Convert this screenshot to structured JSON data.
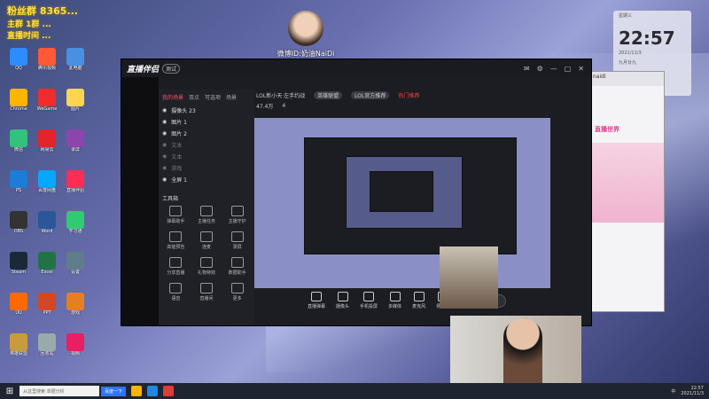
{
  "overlay": {
    "line1": "粉丝群 8365...",
    "line2": "主群 1群 ...",
    "line3": "直播时间 ..."
  },
  "weibo": {
    "text": "微博ID:奶油NaiDi"
  },
  "desktop": {
    "icons": [
      "QQ",
      "Chrome",
      "微信",
      "PS",
      "OBS",
      "Steam",
      "UU",
      "英雄联盟",
      "腾讯视频",
      "WeGame",
      "网易云",
      "百度网盘",
      "Word",
      "Excel",
      "PPT",
      "回收站",
      "此电脑",
      "图片",
      "录屏",
      "直播伴侣",
      "学习通",
      "设置",
      "游戏",
      "视频"
    ]
  },
  "app": {
    "logo": "直播伴侣",
    "version": "测试",
    "tabs": [
      "我的场景",
      "双点",
      "可选项",
      "场景"
    ],
    "scenes": [
      {
        "label": "摄像头 23",
        "dim": false
      },
      {
        "label": "图片 1",
        "dim": false
      },
      {
        "label": "图片 2",
        "dim": false
      },
      {
        "label": "文本",
        "dim": true
      },
      {
        "label": "文本",
        "dim": true
      },
      {
        "label": "游戏",
        "dim": true
      },
      {
        "label": "全屏 1",
        "dim": false
      }
    ],
    "tools_title": "工具箱",
    "tools": [
      "弹幕助手",
      "主播任务",
      "主播守护",
      "高能预告",
      "连麦",
      "录屏",
      "分享直播",
      "礼物特效",
      "数据助手",
      "语音",
      "直播间",
      "更多"
    ],
    "room": {
      "title": "LOL新小天·左手约战",
      "category": "英雄联盟",
      "status": "LOL官方推荐",
      "hot": "热门推荐",
      "viewers": "47.4万",
      "likes": "4"
    },
    "bottom_buttons": [
      "直播弹幕",
      "摄像头",
      "手机投屏",
      "多媒体",
      "麦克风",
      "扬声器"
    ],
    "start_live": "开始直播"
  },
  "clock": {
    "time": "22:57",
    "date": "2021/11/3",
    "weekday": "星期三",
    "lunar": "九月廿九"
  },
  "qq": {
    "name": "naidi",
    "banner": "直播世界"
  },
  "taskbar": {
    "search_placeholder": "从这里搜索 单据分析",
    "search_button": "百度一下",
    "time": "22:57",
    "date": "2021/11/3",
    "input_method": "中"
  },
  "colors": {
    "accent": "#ff4d6d",
    "overlay_text": "#ffe23a",
    "taskbar": "#1f2530"
  }
}
